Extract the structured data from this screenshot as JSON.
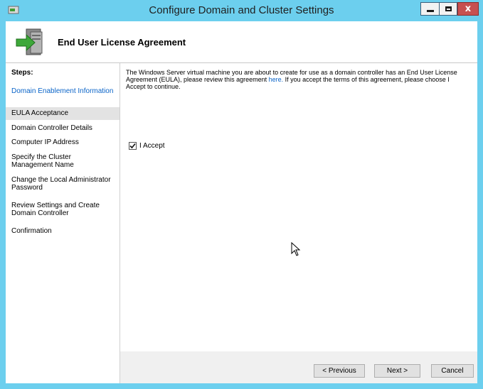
{
  "window": {
    "title": "Configure Domain and Cluster Settings",
    "close_glyph": "x"
  },
  "header": {
    "title": "End User License Agreement"
  },
  "steps": {
    "title": "Steps:",
    "items": [
      {
        "label": "Domain Enablement Information",
        "state": "link"
      },
      {
        "label": "EULA Acceptance",
        "state": "current"
      },
      {
        "label": "Domain Controller Details",
        "state": "normal"
      },
      {
        "label": "Computer IP Address",
        "state": "normal"
      },
      {
        "label": "Specify the Cluster Management Name",
        "state": "normal"
      },
      {
        "label": "Change the Local Administrator Password",
        "state": "normal"
      },
      {
        "label": "Review Settings and Create Domain Controller",
        "state": "normal"
      },
      {
        "label": "Confirmation",
        "state": "normal"
      }
    ]
  },
  "content": {
    "intro_before_link": "The Windows Server virtual machine you are about to create for use as a domain controller has an End User License Agreement (EULA), please review this agreement ",
    "intro_link": "here.",
    "intro_after_link": " If you accept the terms of this agreement, please choose I Accept to continue.",
    "accept_label": "I Accept",
    "accept_checked": true
  },
  "footer": {
    "previous_label": "< Previous",
    "next_label": "Next >",
    "cancel_label": "Cancel"
  },
  "colors": {
    "titlebar": "#6ccfee",
    "link": "#0a64c8",
    "current_step_bg": "#e3e3e3",
    "close_button": "#c75050"
  },
  "icons": {
    "app": "server-config-icon",
    "header": "server-wizard-icon",
    "checkmark": "checkmark-icon",
    "cursor": "mouse-pointer-icon"
  }
}
